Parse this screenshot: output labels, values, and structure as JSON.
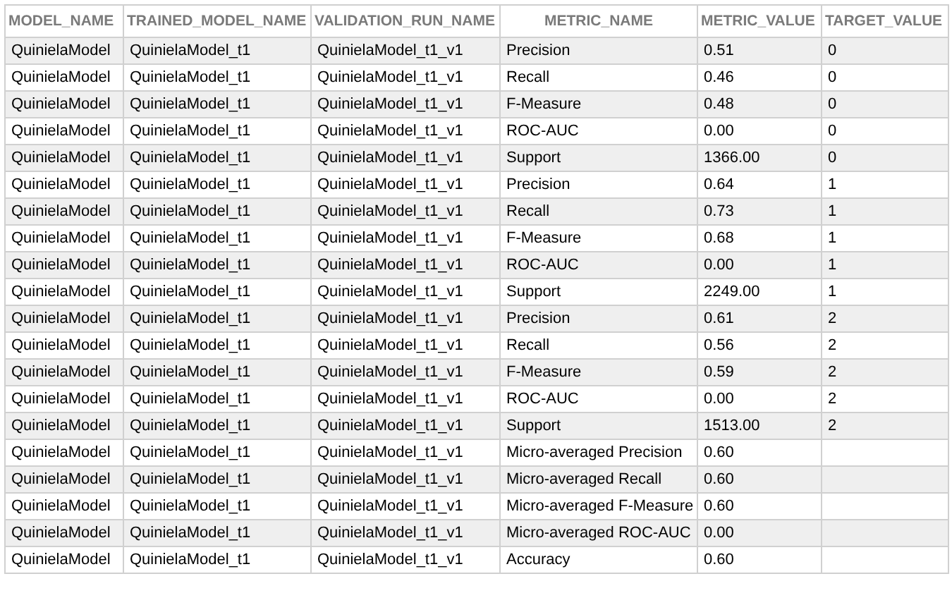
{
  "table": {
    "columns": [
      {
        "label": "MODEL_NAME"
      },
      {
        "label": "TRAINED_MODEL_NAME"
      },
      {
        "label": "VALIDATION_RUN_NAME"
      },
      {
        "label": "METRIC_NAME"
      },
      {
        "label": "METRIC_VALUE"
      },
      {
        "label": "TARGET_VALUE"
      }
    ],
    "rows": [
      [
        "QuinielaModel",
        "QuinielaModel_t1",
        "QuinielaModel_t1_v1",
        "Precision",
        "0.51",
        "0"
      ],
      [
        "QuinielaModel",
        "QuinielaModel_t1",
        "QuinielaModel_t1_v1",
        "Recall",
        "0.46",
        "0"
      ],
      [
        "QuinielaModel",
        "QuinielaModel_t1",
        "QuinielaModel_t1_v1",
        "F-Measure",
        "0.48",
        "0"
      ],
      [
        "QuinielaModel",
        "QuinielaModel_t1",
        "QuinielaModel_t1_v1",
        "ROC-AUC",
        "0.00",
        "0"
      ],
      [
        "QuinielaModel",
        "QuinielaModel_t1",
        "QuinielaModel_t1_v1",
        "Support",
        "1366.00",
        "0"
      ],
      [
        "QuinielaModel",
        "QuinielaModel_t1",
        "QuinielaModel_t1_v1",
        "Precision",
        "0.64",
        "1"
      ],
      [
        "QuinielaModel",
        "QuinielaModel_t1",
        "QuinielaModel_t1_v1",
        "Recall",
        "0.73",
        "1"
      ],
      [
        "QuinielaModel",
        "QuinielaModel_t1",
        "QuinielaModel_t1_v1",
        "F-Measure",
        "0.68",
        "1"
      ],
      [
        "QuinielaModel",
        "QuinielaModel_t1",
        "QuinielaModel_t1_v1",
        "ROC-AUC",
        "0.00",
        "1"
      ],
      [
        "QuinielaModel",
        "QuinielaModel_t1",
        "QuinielaModel_t1_v1",
        "Support",
        "2249.00",
        "1"
      ],
      [
        "QuinielaModel",
        "QuinielaModel_t1",
        "QuinielaModel_t1_v1",
        "Precision",
        "0.61",
        "2"
      ],
      [
        "QuinielaModel",
        "QuinielaModel_t1",
        "QuinielaModel_t1_v1",
        "Recall",
        "0.56",
        "2"
      ],
      [
        "QuinielaModel",
        "QuinielaModel_t1",
        "QuinielaModel_t1_v1",
        "F-Measure",
        "0.59",
        "2"
      ],
      [
        "QuinielaModel",
        "QuinielaModel_t1",
        "QuinielaModel_t1_v1",
        "ROC-AUC",
        "0.00",
        "2"
      ],
      [
        "QuinielaModel",
        "QuinielaModel_t1",
        "QuinielaModel_t1_v1",
        "Support",
        "1513.00",
        "2"
      ],
      [
        "QuinielaModel",
        "QuinielaModel_t1",
        "QuinielaModel_t1_v1",
        "Micro-averaged Precision",
        "0.60"
      ],
      [
        "QuinielaModel",
        "QuinielaModel_t1",
        "QuinielaModel_t1_v1",
        "Micro-averaged Recall",
        "0.60"
      ],
      [
        "QuinielaModel",
        "QuinielaModel_t1",
        "QuinielaModel_t1_v1",
        "Micro-averaged F-Measure",
        "0.60"
      ],
      [
        "QuinielaModel",
        "QuinielaModel_t1",
        "QuinielaModel_t1_v1",
        "Micro-averaged ROC-AUC",
        "0.00"
      ],
      [
        "QuinielaModel",
        "QuinielaModel_t1",
        "QuinielaModel_t1_v1",
        "Accuracy",
        "0.60"
      ]
    ]
  }
}
